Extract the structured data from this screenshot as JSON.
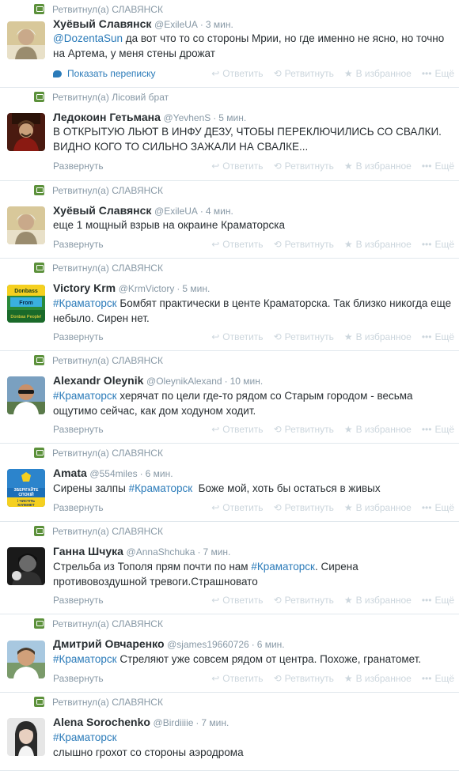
{
  "actions": {
    "reply": "Ответить",
    "retweet": "Ретвитнуть",
    "favorite": "В избранное",
    "more": "Ещё"
  },
  "labels": {
    "expand": "Развернуть",
    "show_conversation": "Показать переписку"
  },
  "tweets": [
    {
      "retweeted_by": "Ретвитнул(а) СЛАВЯНСК",
      "name": "Хуёвый Славянск",
      "handle": "@ExileUA",
      "time": "3 мин.",
      "parts": [
        {
          "t": "@DozentaSun",
          "k": "mention"
        },
        {
          "t": " да вот что то со стороны Мрии, но где именно не ясно, но точно на Артема, у меня стены дрожат",
          "k": ""
        }
      ],
      "footer": "conv"
    },
    {
      "retweeted_by": "Ретвитнул(а) Лісовий брат",
      "name": "Ледокоин Гетьмана",
      "handle": "@YevhenS",
      "time": "5 мин.",
      "parts": [
        {
          "t": "В ОТКРЫТУЮ ЛЬЮТ В ИНФУ ДЕЗУ, ЧТОБЫ ПЕРЕКЛЮЧИЛИСЬ СО СВАЛКИ.\nВИДНО КОГО ТО СИЛЬНО ЗАЖАЛИ НА СВАЛКЕ...",
          "k": ""
        }
      ],
      "footer": "expand"
    },
    {
      "retweeted_by": "Ретвитнул(а) СЛАВЯНСК",
      "name": "Хуёвый Славянск",
      "handle": "@ExileUA",
      "time": "4 мин.",
      "parts": [
        {
          "t": "еще 1 мощный взрыв на окраине Краматорска",
          "k": ""
        }
      ],
      "footer": "expand"
    },
    {
      "retweeted_by": "Ретвитнул(а) СЛАВЯНСК",
      "name": "Victory Krm",
      "handle": "@KrmVictory",
      "time": "5 мин.",
      "parts": [
        {
          "t": "#Краматорск",
          "k": "hashtag"
        },
        {
          "t": " Бомбят практически в центе Краматорска. Так близко никогда еще небыло. Сирен нет.",
          "k": ""
        }
      ],
      "footer": "expand"
    },
    {
      "retweeted_by": "Ретвитнул(а) СЛАВЯНСК",
      "name": "Alexandr Oleynik",
      "handle": "@OleynikAlexand",
      "time": "10 мин.",
      "parts": [
        {
          "t": "#Краматорск",
          "k": "hashtag"
        },
        {
          "t": " херячат по цели где-то рядом со Старым городом - весьма ощутимо сейчас, как дом ходуном ходит.",
          "k": ""
        }
      ],
      "footer": "expand"
    },
    {
      "retweeted_by": "Ретвитнул(а) СЛАВЯНСК",
      "name": "Amata",
      "handle": "@554miles",
      "time": "6 мин.",
      "parts": [
        {
          "t": "Сирены залпы ",
          "k": ""
        },
        {
          "t": "#Краматорск",
          "k": "hashtag"
        },
        {
          "t": "  Боже мой, хоть бы остаться в живых",
          "k": ""
        }
      ],
      "footer": "expand"
    },
    {
      "retweeted_by": "Ретвитнул(а) СЛАВЯНСК",
      "name": "Ганна Шчука",
      "handle": "@AnnaShchuka",
      "time": "7 мин.",
      "parts": [
        {
          "t": "Стрельба из Тополя прям почти по нам ",
          "k": ""
        },
        {
          "t": "#Краматорск",
          "k": "hashtag"
        },
        {
          "t": ". Сирена противовоздушной тревоги.Страшновато",
          "k": ""
        }
      ],
      "footer": "expand"
    },
    {
      "retweeted_by": "Ретвитнул(а) СЛАВЯНСК",
      "name": "Дмитрий Овчаренко",
      "handle": "@sjames19660726",
      "time": "6 мин.",
      "parts": [
        {
          "t": "#Краматорск",
          "k": "hashtag"
        },
        {
          "t": " Стреляют уже совсем рядом от центра. Похоже, гранатомет.",
          "k": ""
        }
      ],
      "footer": "expand"
    },
    {
      "retweeted_by": "Ретвитнул(а) СЛАВЯНСК",
      "name": "Alena Sorochenko",
      "handle": "@Birdiiiie",
      "time": "7 мин.",
      "parts": [
        {
          "t": "#Краматорск",
          "k": "hashtag"
        },
        {
          "t": "\nслышно грохот со стороны аэродрома",
          "k": ""
        }
      ],
      "footer": "none"
    }
  ],
  "avatar_logo_text": {
    "victory_top": "Donbass",
    "victory_mid": "From",
    "victory_bottom": "Donbas People!",
    "amata_lines": [
      "ЗБЕРІГАЙТЕ",
      "СПОКІЙ",
      "і",
      "ЧИСТІТЬ",
      "КУЛЕМЕТ"
    ]
  },
  "colors": {
    "link": "#2b7bb9",
    "muted": "#8899a6",
    "action_disabled": "#ccd6dd",
    "retweet_badge": "#5c913b",
    "divider": "#e1e8ed"
  }
}
